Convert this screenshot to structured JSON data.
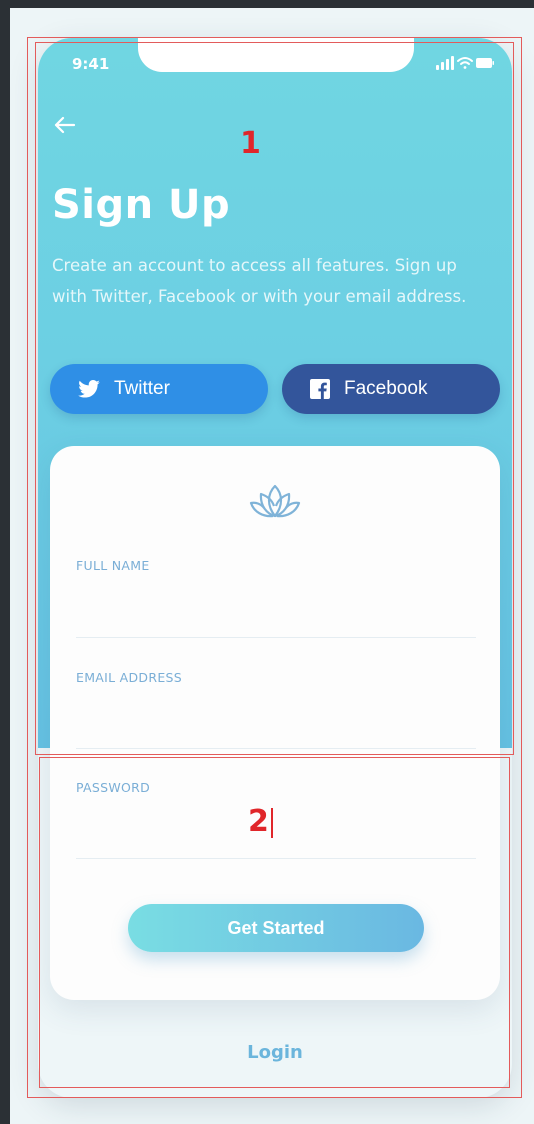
{
  "status_bar": {
    "time": "9:41",
    "icons": [
      "signal-icon",
      "wifi-icon",
      "battery-icon"
    ]
  },
  "header": {
    "back_icon": "arrow-left-icon",
    "title": "Sign Up",
    "subtitle": "Create an account to access all features. Sign up with Twitter, Facebook or with your email address."
  },
  "social": {
    "twitter_label": "Twitter",
    "facebook_label": "Facebook",
    "twitter_color": "#2f8fe6",
    "facebook_color": "#33559b"
  },
  "form": {
    "logo_icon": "lotus-icon",
    "fields": [
      {
        "label": "FULL NAME",
        "value": ""
      },
      {
        "label": "EMAIL ADDRESS",
        "value": ""
      },
      {
        "label": "PASSWORD",
        "value": ""
      }
    ],
    "submit_label": "Get Started"
  },
  "footer": {
    "login_label": "Login"
  },
  "annotations": [
    {
      "number": "1"
    },
    {
      "number": "2"
    }
  ],
  "colors": {
    "accent": "#6cc8e2",
    "label": "#7aaed6",
    "annotation": "#e0262a"
  }
}
